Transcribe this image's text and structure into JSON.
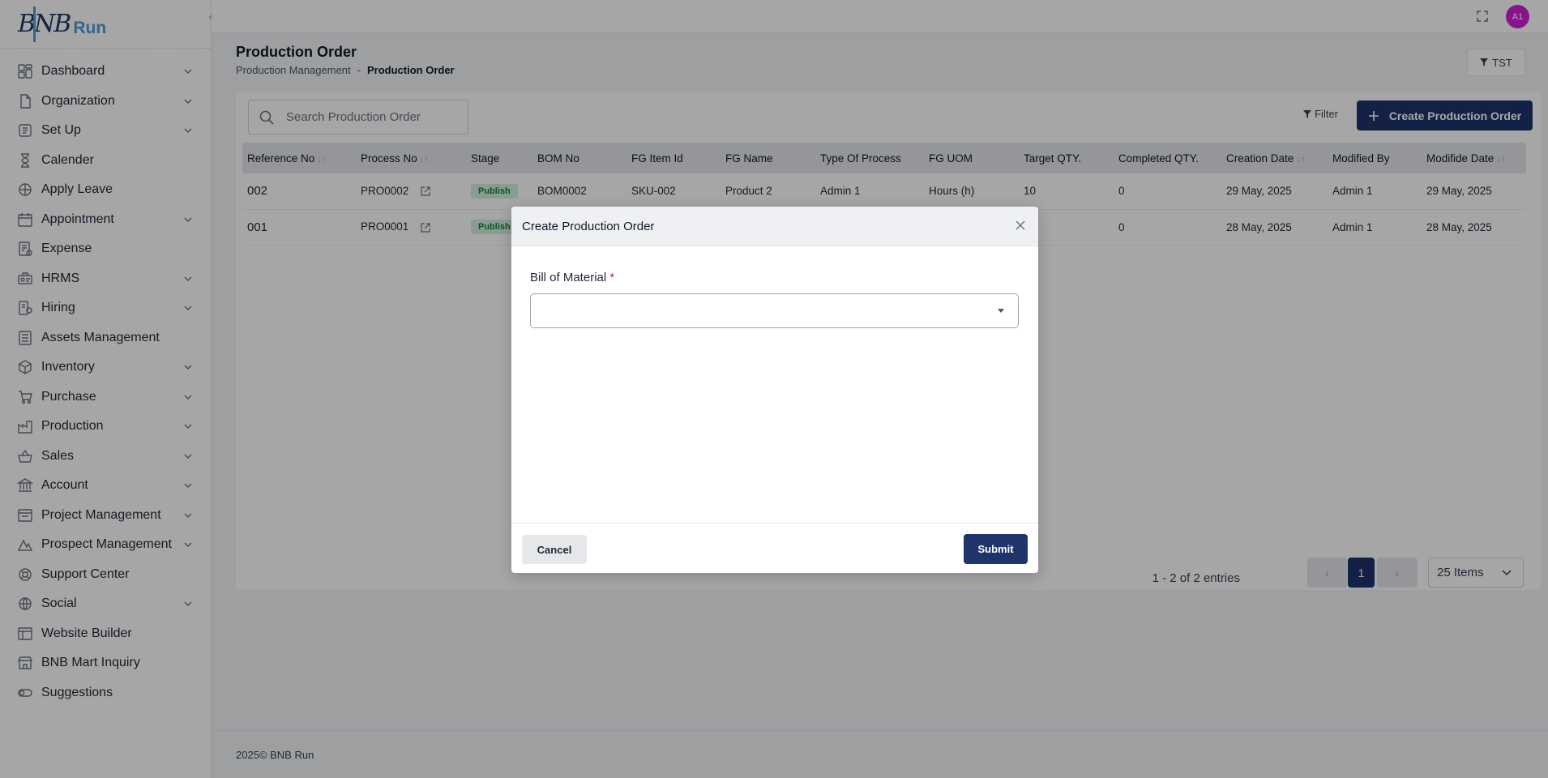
{
  "app": {
    "logo_text": "BNB",
    "logo_accent": "Run",
    "brand_color": "#20346c"
  },
  "sidebar": {
    "items": [
      {
        "label": "Dashboard",
        "icon": "dashboard-icon",
        "chevron": true
      },
      {
        "label": "Organization",
        "icon": "organization-icon",
        "chevron": true
      },
      {
        "label": "Set Up",
        "icon": "setup-icon",
        "chevron": true
      },
      {
        "label": "Calender",
        "icon": "hourglass-icon",
        "chevron": false
      },
      {
        "label": "Apply Leave",
        "icon": "leave-icon",
        "chevron": false
      },
      {
        "label": "Appointment",
        "icon": "calendar-icon",
        "chevron": true
      },
      {
        "label": "Expense",
        "icon": "expense-icon",
        "chevron": false
      },
      {
        "label": "HRMS",
        "icon": "hrms-icon",
        "chevron": true
      },
      {
        "label": "Hiring",
        "icon": "hiring-icon",
        "chevron": true
      },
      {
        "label": "Assets Management",
        "icon": "assets-icon",
        "chevron": false
      },
      {
        "label": "Inventory",
        "icon": "inventory-icon",
        "chevron": true
      },
      {
        "label": "Purchase",
        "icon": "cart-icon",
        "chevron": true
      },
      {
        "label": "Production",
        "icon": "production-icon",
        "chevron": true
      },
      {
        "label": "Sales",
        "icon": "sales-icon",
        "chevron": true
      },
      {
        "label": "Account",
        "icon": "bank-icon",
        "chevron": true
      },
      {
        "label": "Project Management",
        "icon": "project-icon",
        "chevron": true
      },
      {
        "label": "Prospect Management",
        "icon": "prospect-icon",
        "chevron": true
      },
      {
        "label": "Support Center",
        "icon": "support-icon",
        "chevron": false
      },
      {
        "label": "Social",
        "icon": "social-icon",
        "chevron": true
      },
      {
        "label": "Website Builder",
        "icon": "website-icon",
        "chevron": false
      },
      {
        "label": "BNB Mart Inquiry",
        "icon": "store-icon",
        "chevron": false
      },
      {
        "label": "Suggestions",
        "icon": "toggle-icon",
        "chevron": false
      }
    ]
  },
  "header": {
    "avatar_initials": "A1"
  },
  "page": {
    "title": "Production Order",
    "breadcrumb": [
      "Production Management",
      "Production Order"
    ],
    "breadcrumb_sep": "-",
    "tst_label": "TST",
    "search_placeholder": "Search Production Order",
    "filter_label": "Filter",
    "create_label": "Create Production Order"
  },
  "table": {
    "columns": [
      "Reference No",
      "Process No",
      "Stage",
      "BOM No",
      "FG Item Id",
      "FG Name",
      "Type Of Process",
      "FG UOM",
      "Target QTY.",
      "Completed QTY.",
      "Creation Date",
      "Modified By",
      "Modifide Date"
    ],
    "rows": [
      {
        "ref": "002",
        "process": "PRO0002",
        "stage": "Publish",
        "bom": "BOM0002",
        "item": "SKU-002",
        "name": "Product 2",
        "type": "Admin 1",
        "uom": "Hours (h)",
        "target": "10",
        "completed": "0",
        "created": "29 May, 2025",
        "modified_by": "Admin 1",
        "modified": "29 May, 2025"
      },
      {
        "ref": "001",
        "process": "PRO0001",
        "stage": "Publish",
        "bom": "",
        "item": "",
        "name": "",
        "type": "",
        "uom": "",
        "target": "",
        "completed": "0",
        "created": "28 May, 2025",
        "modified_by": "Admin 1",
        "modified": "28 May, 2025"
      }
    ]
  },
  "pagination": {
    "entries_text": "1 - 2 of 2 entries",
    "current_page": "1",
    "items_per_page": "25 Items"
  },
  "footer": {
    "text": "2025© BNB Run"
  },
  "modal": {
    "title": "Create Production Order",
    "field_label": "Bill of Material",
    "required_mark": "*",
    "select_value": "",
    "cancel_label": "Cancel",
    "submit_label": "Submit"
  }
}
